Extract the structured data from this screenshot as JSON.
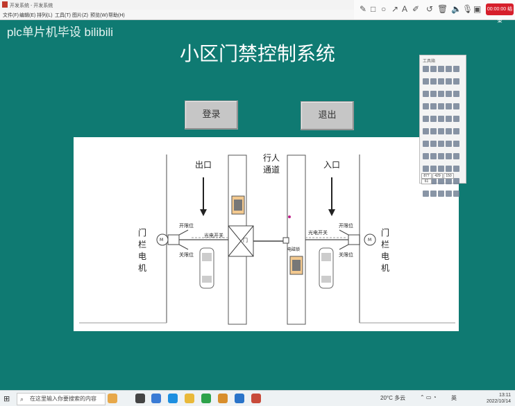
{
  "window": {
    "title": "开发系统 - 开发系统"
  },
  "menu": [
    "文件(F)",
    "编辑(E)",
    "排列(L)",
    "工具(T)",
    "图片(Z)",
    "预览(W)",
    "帮助(H)"
  ],
  "recorder": {
    "timer": "00:00:00 结束"
  },
  "watermark": "plc单片机毕设 bilibili",
  "page": {
    "title": "小区门禁控制系统"
  },
  "buttons": {
    "login": "登录",
    "exit": "退出"
  },
  "scene": {
    "exit_label": "出口",
    "entry_label": "入口",
    "walkway": "行人通道",
    "motor_left": "门栏电机",
    "motor_right": "门栏电机",
    "left": {
      "open_limit": "开限位",
      "close_limit": "关限位",
      "photo_switch": "光电开关"
    },
    "right": {
      "open_limit": "开限位",
      "close_limit": "关限位",
      "photo_switch": "光电开关"
    },
    "lock": "电磁锁",
    "motor_symbol": "M",
    "turnstile_symbol": "门"
  },
  "toolbox": {
    "title": "工具箱",
    "coords": [
      "877",
      "429",
      "150",
      "61"
    ]
  },
  "taskbar": {
    "search_placeholder": "在这里输入你要搜索的内容",
    "weather": "20°C 多云",
    "ime": "英",
    "time": "13:11",
    "date": "2022/10/14"
  },
  "colors": {
    "background": "#0f7a72",
    "button": "#c6c6c6",
    "recorder_red": "#d61f2b"
  }
}
